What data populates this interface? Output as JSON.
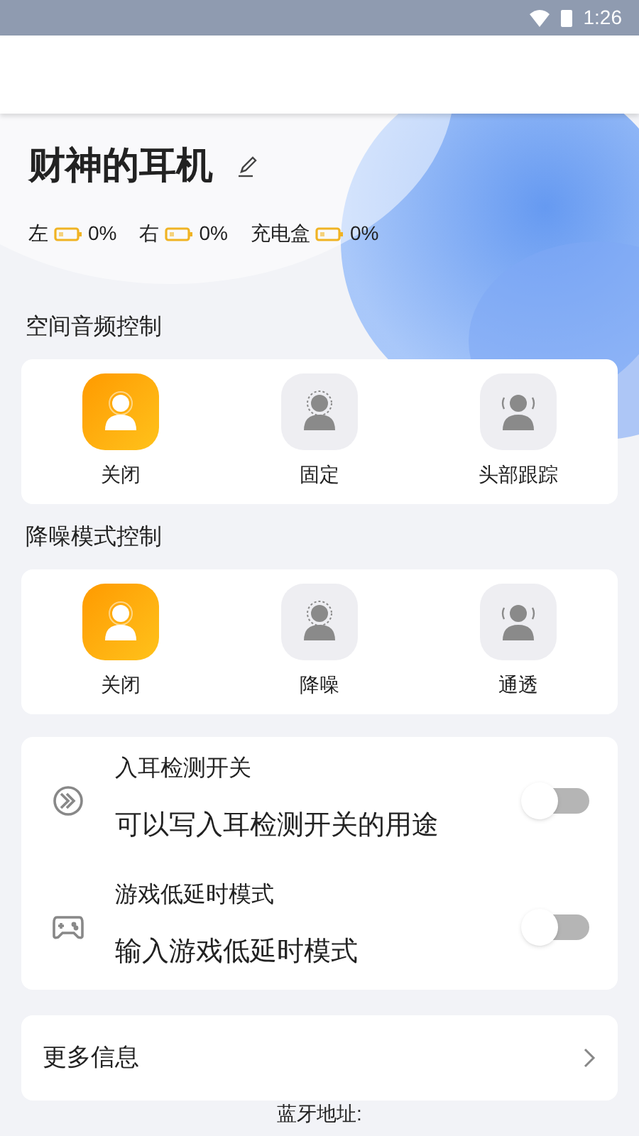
{
  "status_bar": {
    "time": "1:26"
  },
  "device": {
    "name": "财神的耳机"
  },
  "batteries": [
    {
      "label": "左",
      "reading": "0%"
    },
    {
      "label": "右",
      "reading": "0%"
    },
    {
      "label": "充电盒",
      "reading": "0%"
    }
  ],
  "sections": [
    {
      "title": "空间音频控制",
      "options": [
        {
          "label": "关闭",
          "kind": "off",
          "selected": true
        },
        {
          "label": "固定",
          "kind": "fixed",
          "selected": false
        },
        {
          "label": "头部跟踪",
          "kind": "tracking",
          "selected": false
        }
      ]
    },
    {
      "title": "降噪模式控制",
      "options": [
        {
          "label": "关闭",
          "kind": "off",
          "selected": true
        },
        {
          "label": "降噪",
          "kind": "fixed",
          "selected": false
        },
        {
          "label": "通透",
          "kind": "tracking",
          "selected": false
        }
      ]
    }
  ],
  "settings": [
    {
      "kind": "ear",
      "title": "入耳检测开关",
      "description": "可以写入耳检测开关的用途",
      "on": false
    },
    {
      "kind": "game",
      "title": "游戏低延时模式",
      "description": "输入游戏低延时模式",
      "on": false
    }
  ],
  "more_info": {
    "label": "更多信息"
  },
  "footer": {
    "text": "蓝牙地址:"
  }
}
